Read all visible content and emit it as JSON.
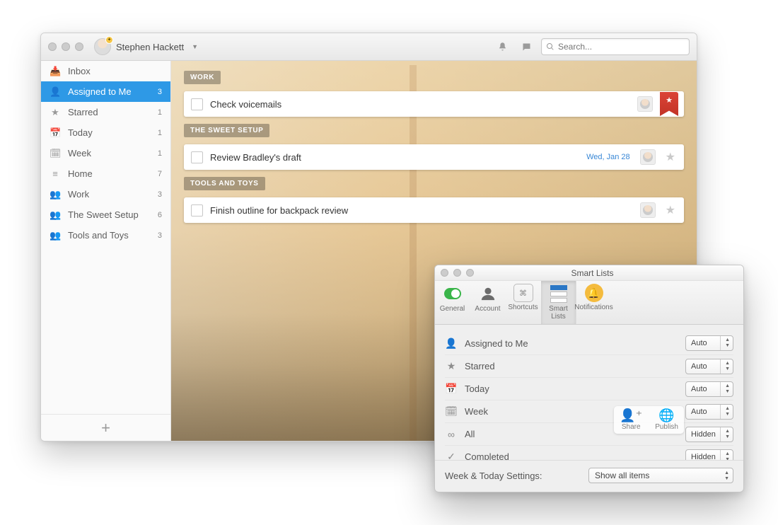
{
  "titlebar": {
    "user_name": "Stephen Hackett",
    "search_placeholder": "Search..."
  },
  "sidebar": {
    "items": [
      {
        "icon": "inbox-icon",
        "glyph": "📥",
        "label": "Inbox",
        "count": ""
      },
      {
        "icon": "assigned-icon",
        "glyph": "👤",
        "label": "Assigned to Me",
        "count": "3",
        "selected": true
      },
      {
        "icon": "star-icon",
        "glyph": "★",
        "label": "Starred",
        "count": "1"
      },
      {
        "icon": "today-icon",
        "glyph": "📅",
        "label": "Today",
        "count": "1"
      },
      {
        "icon": "week-icon",
        "glyph": "🗓",
        "label": "Week",
        "count": "1"
      },
      {
        "icon": "home-icon",
        "glyph": "≡",
        "label": "Home",
        "count": "7"
      },
      {
        "icon": "people-icon",
        "glyph": "👥",
        "label": "Work",
        "count": "3"
      },
      {
        "icon": "people-icon",
        "glyph": "👥",
        "label": "The Sweet Setup",
        "count": "6"
      },
      {
        "icon": "people-icon",
        "glyph": "👥",
        "label": "Tools and Toys",
        "count": "3"
      }
    ]
  },
  "sections": [
    {
      "title": "WORK",
      "tasks": [
        {
          "title": "Check voicemails",
          "date": "",
          "avatar": true,
          "starred": true,
          "ribbon": true
        }
      ]
    },
    {
      "title": "THE SWEET SETUP",
      "tasks": [
        {
          "title": "Review Bradley's draft",
          "date": "Wed, Jan 28",
          "avatar": true,
          "starred": false,
          "ribbon": false
        }
      ]
    },
    {
      "title": "TOOLS AND TOYS",
      "tasks": [
        {
          "title": "Finish outline for backpack review",
          "date": "",
          "avatar": true,
          "starred": false,
          "ribbon": false
        }
      ]
    }
  ],
  "bottomActions": {
    "share": "Share",
    "publish": "Publish"
  },
  "settings": {
    "window_title": "Smart Lists",
    "tabs": [
      {
        "id": "general",
        "label": "General"
      },
      {
        "id": "account",
        "label": "Account"
      },
      {
        "id": "shortcuts",
        "label": "Shortcuts"
      },
      {
        "id": "smartlists",
        "label": "Smart Lists",
        "active": true
      },
      {
        "id": "notifications",
        "label": "Notifications"
      }
    ],
    "rows": [
      {
        "icon": "assigned-icon",
        "glyph": "👤",
        "label": "Assigned to Me",
        "value": "Auto"
      },
      {
        "icon": "star-icon",
        "glyph": "★",
        "label": "Starred",
        "value": "Auto"
      },
      {
        "icon": "today-icon",
        "glyph": "📅",
        "label": "Today",
        "value": "Auto"
      },
      {
        "icon": "week-icon",
        "glyph": "🗓",
        "label": "Week",
        "value": "Auto"
      },
      {
        "icon": "infinity-icon",
        "glyph": "∞",
        "label": "All",
        "value": "Hidden"
      },
      {
        "icon": "check-icon",
        "glyph": "✓",
        "label": "Completed",
        "value": "Hidden"
      }
    ],
    "footer_label": "Week & Today Settings:",
    "footer_value": "Show all items"
  }
}
